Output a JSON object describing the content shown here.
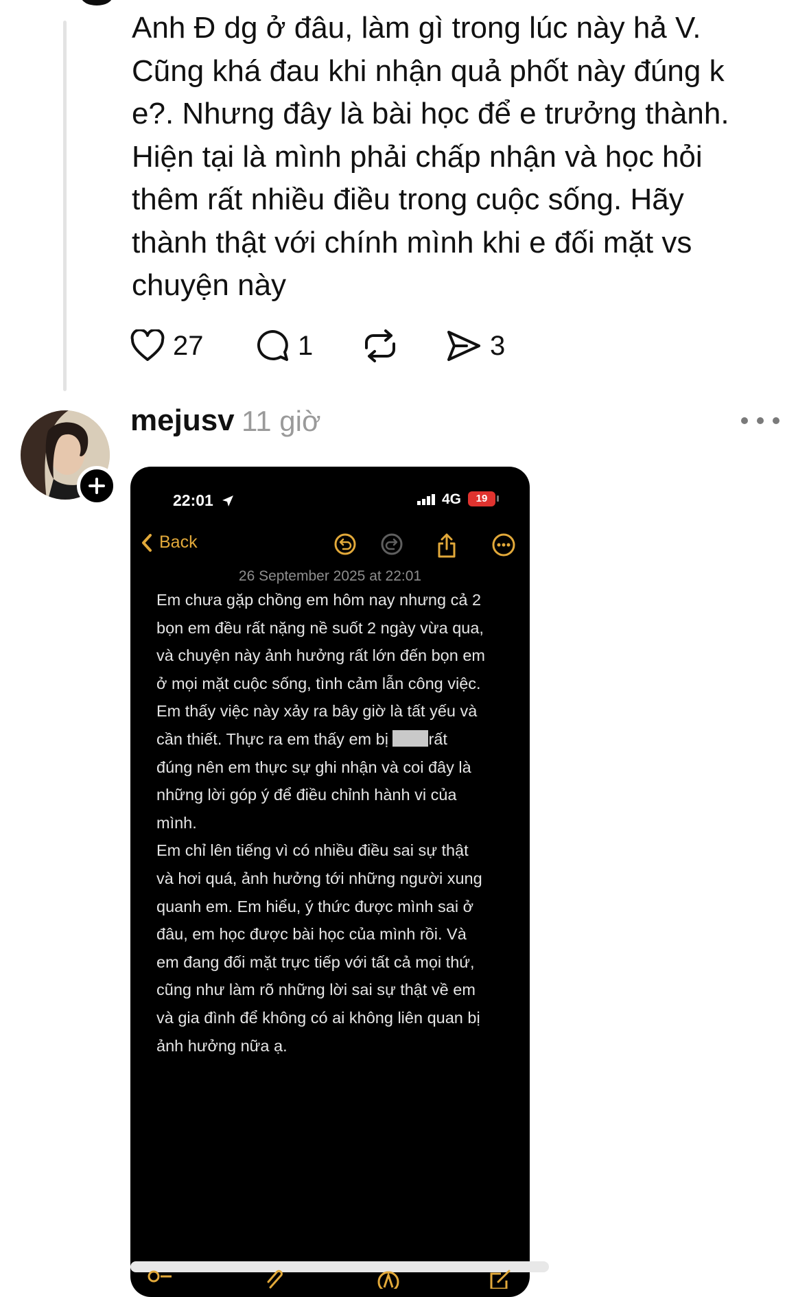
{
  "reply": {
    "text": "Anh Đ dg ở đâu, làm gì trong lúc này hả V.\nCũng khá đau khi nhận quả phốt này đúng k\ne?. Nhưng đây là bài học để e trưởng thành.\nHiện tại là mình phải chấp nhận và học hỏi\nthêm rất nhiều điều trong cuộc sống. Hãy\nthành thật với chính mình khi e đối mặt vs\nchuyện này",
    "actions": {
      "likes": "27",
      "comments": "1",
      "shares": "3"
    }
  },
  "post": {
    "username": "mejusv",
    "timestamp": "11 giờ",
    "screenshot": {
      "status_bar": {
        "time": "22:01",
        "network": "4G",
        "battery": "19"
      },
      "back_label": "Back",
      "note_date": "26 September 2025 at 22:01",
      "note_lines": [
        "Em chưa gặp chồng em hôm nay nhưng cả 2",
        "bọn em đều rất nặng nề suốt 2 ngày vừa qua,",
        "và chuyện này ảnh hưởng rất lớn đến bọn em",
        "ở mọi mặt cuộc sống, tình cảm lẫn công việc.",
        "Em thấy việc này xảy ra bây giờ là tất yếu và",
        "cần thiết. Thực ra em thấy em bị",
        "rất",
        "đúng nên em thực sự ghi nhận và coi đây là",
        "những lời góp ý để điều chỉnh hành vi của",
        "mình.",
        "Em chỉ lên tiếng vì có nhiều điều sai sự thật",
        "và hơi quá, ảnh hưởng tới những người xung",
        "quanh em. Em hiểu, ý thức được mình sai ở",
        "đâu, em học được bài học của mình rồi. Và",
        "em đang đối mặt trực tiếp với tất cả mọi thứ,",
        "cũng như làm rõ những lời sai sự thật về em",
        "và gia đình để không có ai không liên quan bị",
        "ảnh hưởng nữa ạ."
      ]
    }
  },
  "colors": {
    "accent": "#e2a93a",
    "note_background": "#000000",
    "timestamp": "#9a9a9a"
  },
  "icons": [
    "heart-icon",
    "comment-icon",
    "repost-icon",
    "send-icon",
    "more-icon",
    "plus-icon",
    "location-arrow-icon",
    "signal-icon",
    "chevron-left-icon",
    "undo-icon",
    "redo-icon",
    "share-icon",
    "ellipsis-circle-icon",
    "checklist-icon",
    "attachment-icon",
    "markup-icon",
    "compose-icon"
  ]
}
